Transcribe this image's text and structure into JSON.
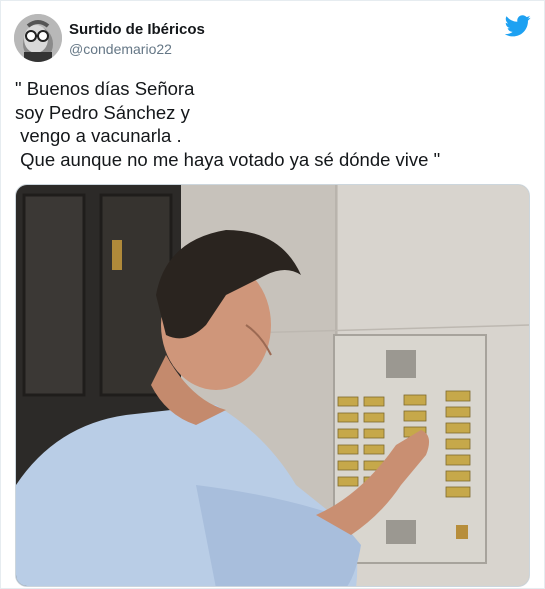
{
  "author": {
    "name": "Surtido de Ibéricos",
    "handle": "@condemario22"
  },
  "tweet": {
    "lines": [
      "\" Buenos días Señora",
      "soy Pedro Sánchez y",
      " vengo a vacunarla .",
      " Que aunque no me haya votado ya sé dónde vive \""
    ]
  },
  "icons": {
    "platform": "twitter-bird-icon"
  },
  "colors": {
    "twitter_blue": "#1da1f2",
    "text": "#14171a",
    "secondary": "#657786"
  }
}
